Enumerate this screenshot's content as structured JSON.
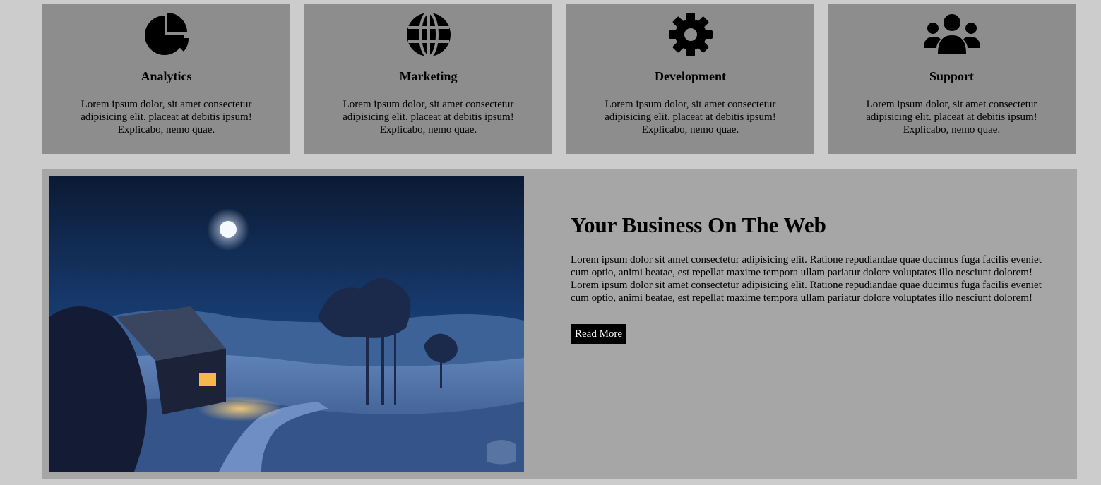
{
  "services": [
    {
      "icon": "pie-chart-icon",
      "title": "Analytics",
      "text": "Lorem ipsum dolor, sit amet consectetur adipisicing elit. placeat at debitis ipsum! Explicabo, nemo quae."
    },
    {
      "icon": "globe-icon",
      "title": "Marketing",
      "text": "Lorem ipsum dolor, sit amet consectetur adipisicing elit. placeat at debitis ipsum! Explicabo, nemo quae."
    },
    {
      "icon": "gear-icon",
      "title": "Development",
      "text": "Lorem ipsum dolor, sit amet consectetur adipisicing elit. placeat at debitis ipsum! Explicabo, nemo quae."
    },
    {
      "icon": "users-icon",
      "title": "Support",
      "text": "Lorem ipsum dolor, sit amet consectetur adipisicing elit. placeat at debitis ipsum! Explicabo, nemo quae."
    }
  ],
  "feature": {
    "image": "night-landscape-cabin-image",
    "heading": "Your Business On The Web",
    "body": "Lorem ipsum dolor sit amet consectetur adipisicing elit. Ratione repudiandae quae ducimus fuga facilis eveniet cum optio, animi beatae, est repellat maxime tempora ullam pariatur dolore voluptates illo nesciunt dolorem! Lorem ipsum dolor sit amet consectetur adipisicing elit. Ratione repudiandae quae ducimus fuga facilis eveniet cum optio, animi beatae, est repellat maxime tempora ullam pariatur dolore voluptates illo nesciunt dolorem!",
    "button_label": "Read More"
  },
  "colors": {
    "page_background": "#cccccc",
    "card_background": "#8d8d8d",
    "feature_background": "#a6a6a6",
    "button_background": "#000000",
    "button_text": "#ffffff"
  }
}
